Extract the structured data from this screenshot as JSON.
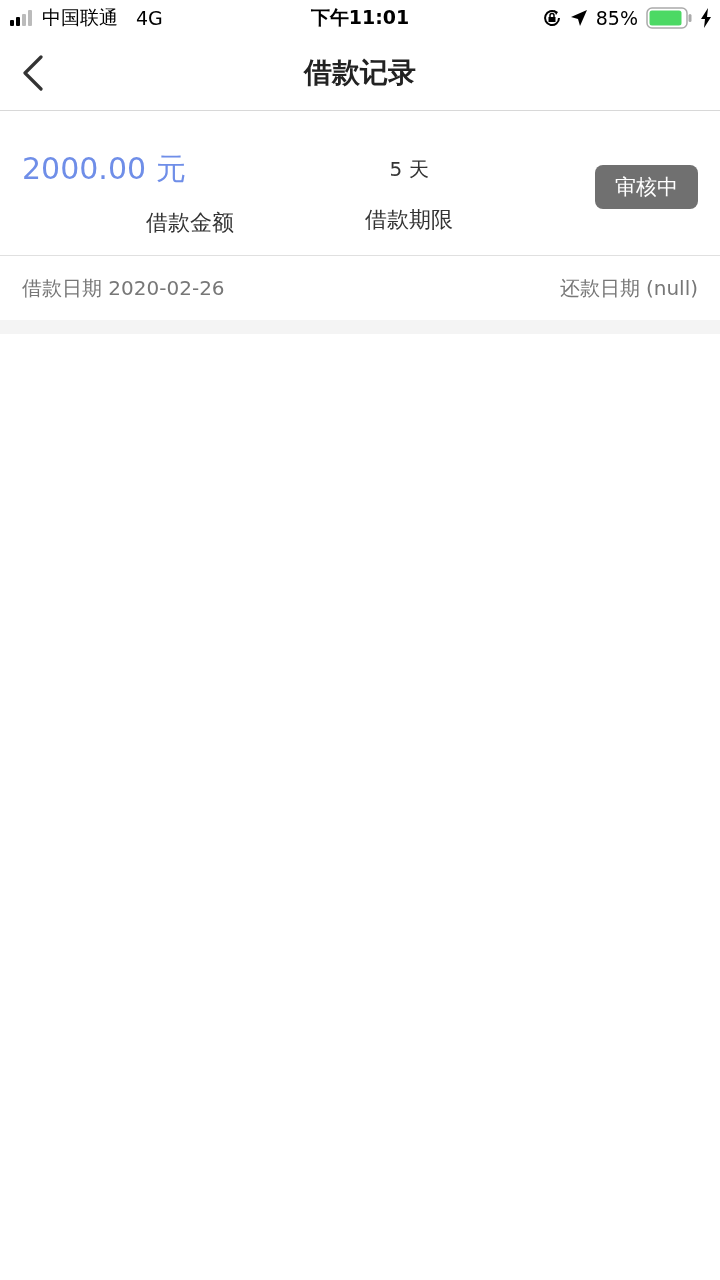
{
  "status_bar": {
    "carrier": "中国联通",
    "network": "4G",
    "time": "下午11:01",
    "battery_percent": "85%"
  },
  "nav": {
    "title": "借款记录"
  },
  "records": [
    {
      "amount": "2000.00 元",
      "amount_label": "借款金额",
      "term": "5 天",
      "term_label": "借款期限",
      "status": "审核中",
      "loan_date": "借款日期 2020-02-26",
      "repay_date": "还款日期 (null)"
    }
  ]
}
